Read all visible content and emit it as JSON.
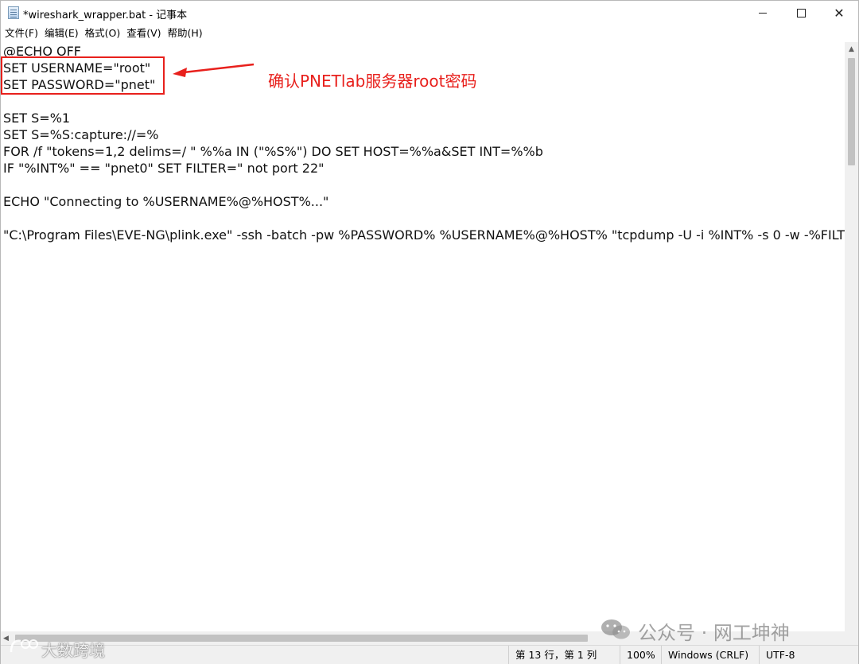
{
  "window": {
    "title": "*wireshark_wrapper.bat - 记事本",
    "icon": "notepad-icon",
    "controls": {
      "minimize": "minimize-icon",
      "maximize": "maximize-icon",
      "close": "✕"
    }
  },
  "menu": {
    "items": [
      "文件(F)",
      "编辑(E)",
      "格式(O)",
      "查看(V)",
      "帮助(H)"
    ]
  },
  "editor": {
    "lines": [
      "@ECHO OFF",
      "SET USERNAME=\"root\"",
      "SET PASSWORD=\"pnet\"",
      "",
      "SET S=%1",
      "SET S=%S:capture://=%",
      "FOR /f \"tokens=1,2 delims=/ \" %%a IN (\"%S%\") DO SET HOST=%%a&SET INT=%%b",
      "IF \"%INT%\" == \"pnet0\" SET FILTER=\" not port 22\"",
      "",
      "ECHO \"Connecting to %USERNAME%@%HOST%...\"",
      "",
      "\"C:\\Program Files\\EVE-NG\\plink.exe\" -ssh -batch -pw %PASSWORD% %USERNAME%@%HOST% \"tcpdump -U -i %INT% -s 0 -w -%FILT"
    ]
  },
  "annotation": {
    "text": "确认PNETlab服务器root密码",
    "color": "#e8201c"
  },
  "statusbar": {
    "position": "第 13 行，第 1 列",
    "zoom": "100%",
    "line_ending": "Windows (CRLF)",
    "encoding": "UTF-8"
  },
  "watermarks": {
    "right": "公众号 · 网工坤神",
    "left": "大数跨境"
  }
}
